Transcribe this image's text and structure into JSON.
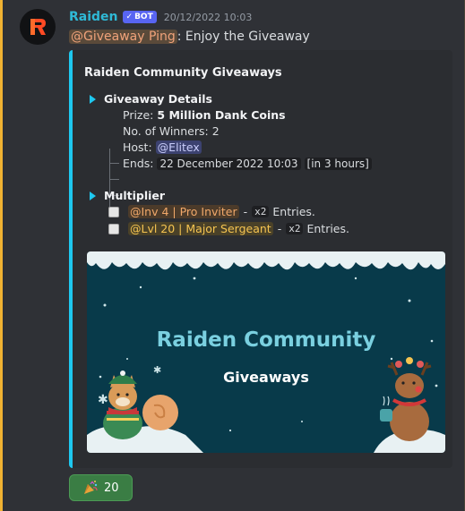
{
  "author": {
    "name": "Raiden",
    "bot_label": "BOT",
    "timestamp": "20/12/2022 10:03"
  },
  "message": {
    "ping": "@Giveaway Ping",
    "text": ": Enjoy the Giveaway"
  },
  "embed": {
    "title": "Raiden Community Giveaways",
    "details_heading": "Giveaway Details",
    "prize_label": "Prize:",
    "prize_value": "5 Million Dank Coins",
    "winners_label": "No. of Winners:",
    "winners_value": "2",
    "host_label": "Host:",
    "host_value": "@Elitex",
    "ends_label": "Ends:",
    "ends_value": "22 December 2022 10:03",
    "ends_relative": "in 3 hours",
    "multiplier_heading": "Multiplier",
    "multipliers": [
      {
        "role": "@Inv 4 | Pro Inviter",
        "sep": "-",
        "factor": "x2",
        "entries": "Entries."
      },
      {
        "role": "@Lvl 20 | Major Sergeant",
        "sep": "-",
        "factor": "x2",
        "entries": "Entries."
      }
    ],
    "accent_color": "#1ec8f0",
    "banner": {
      "title": "Raiden Community",
      "subtitle": "Giveaways"
    }
  },
  "reaction": {
    "emoji": "party-popper-icon",
    "count": "20"
  }
}
